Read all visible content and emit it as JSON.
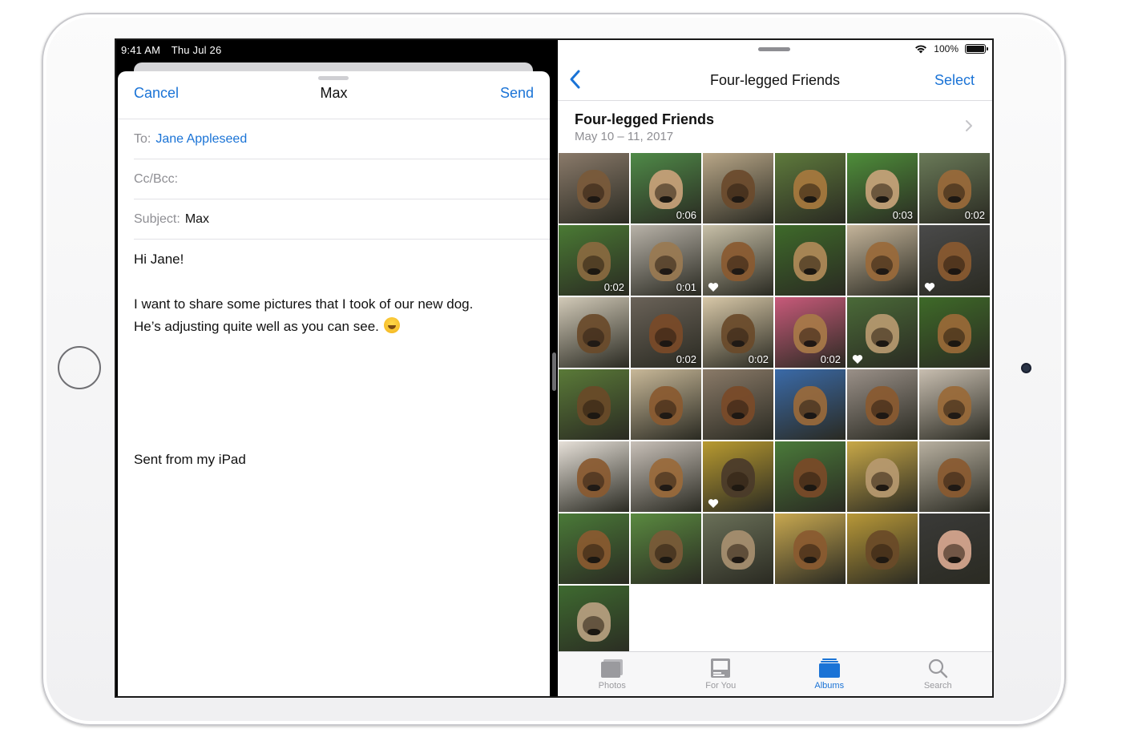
{
  "status": {
    "time": "9:41 AM",
    "date": "Thu Jul 26",
    "battery": "100%"
  },
  "mail": {
    "cancel_label": "Cancel",
    "title": "Max",
    "send_label": "Send",
    "to_label": "To:",
    "to_value": "Jane Appleseed",
    "ccbcc_label": "Cc/Bcc:",
    "subject_label": "Subject:",
    "subject_value": "Max",
    "greeting": "Hi Jane!",
    "body_line1": "I want to share some pictures that I took of our new dog.",
    "body_line2": "He’s adjusting quite well as you can see.",
    "signature": "Sent from my iPad"
  },
  "photos": {
    "nav_title": "Four-legged Friends",
    "select_label": "Select",
    "album_name": "Four-legged Friends",
    "album_dates": "May 10 – 11, 2017",
    "thumbnails": [
      {
        "bg": "#8a7a6a",
        "dog": "#7a5a3a",
        "duration": "",
        "favorite": false
      },
      {
        "bg": "#4f8a48",
        "dog": "#c9a27a",
        "duration": "0:06",
        "favorite": false
      },
      {
        "bg": "#b9a788",
        "dog": "#6b4a2c",
        "duration": "",
        "favorite": false
      },
      {
        "bg": "#5e7a3c",
        "dog": "#a8793e",
        "duration": "",
        "favorite": false
      },
      {
        "bg": "#4e8e3a",
        "dog": "#c7a37a",
        "duration": "0:03",
        "favorite": false
      },
      {
        "bg": "#6a7a58",
        "dog": "#9a6a3a",
        "duration": "0:02",
        "favorite": false
      },
      {
        "bg": "#4a7a34",
        "dog": "#8a6a40",
        "duration": "0:02",
        "favorite": false
      },
      {
        "bg": "#b8b2a8",
        "dog": "#9a7a52",
        "duration": "0:01",
        "favorite": false
      },
      {
        "bg": "#c8c0a8",
        "dog": "#8a5a30",
        "duration": "",
        "favorite": true
      },
      {
        "bg": "#3e6a2a",
        "dog": "#b08a58",
        "duration": "",
        "favorite": false
      },
      {
        "bg": "#c4b49a",
        "dog": "#9a6a3a",
        "duration": "",
        "favorite": false
      },
      {
        "bg": "#4a4a4a",
        "dog": "#8a5a30",
        "duration": "",
        "favorite": true
      },
      {
        "bg": "#d2cab8",
        "dog": "#6a4a2a",
        "duration": "",
        "favorite": false
      },
      {
        "bg": "#6a6258",
        "dog": "#7a4a28",
        "duration": "0:02",
        "favorite": false
      },
      {
        "bg": "#d8c8a8",
        "dog": "#6a4a2a",
        "duration": "0:02",
        "favorite": false
      },
      {
        "bg": "#c85a7a",
        "dog": "#a87a48",
        "duration": "0:02",
        "favorite": false
      },
      {
        "bg": "#4a6a38",
        "dog": "#b89a70",
        "duration": "",
        "favorite": true
      },
      {
        "bg": "#3e6a28",
        "dog": "#9a6a38",
        "duration": "",
        "favorite": false
      },
      {
        "bg": "#5a7a38",
        "dog": "#6a4a28",
        "duration": "",
        "favorite": false
      },
      {
        "bg": "#c8b898",
        "dog": "#8a5a30",
        "duration": "",
        "favorite": false
      },
      {
        "bg": "#8a7a68",
        "dog": "#7a4a28",
        "duration": "",
        "favorite": false
      },
      {
        "bg": "#3a6aa8",
        "dog": "#9a6a3a",
        "duration": "",
        "favorite": false
      },
      {
        "bg": "#9a9088",
        "dog": "#8a5a30",
        "duration": "",
        "favorite": false
      },
      {
        "bg": "#c8beb0",
        "dog": "#9a6a38",
        "duration": "",
        "favorite": false
      },
      {
        "bg": "#e6e0d8",
        "dog": "#8a5a30",
        "duration": "",
        "favorite": false
      },
      {
        "bg": "#c8c0b8",
        "dog": "#9a6a3a",
        "duration": "",
        "favorite": false
      },
      {
        "bg": "#b89a30",
        "dog": "#4a3a2a",
        "duration": "",
        "favorite": true
      },
      {
        "bg": "#4a7a3a",
        "dog": "#7a4a28",
        "duration": "",
        "favorite": false
      },
      {
        "bg": "#c8a848",
        "dog": "#b89a70",
        "duration": "",
        "favorite": false
      },
      {
        "bg": "#b8b0a0",
        "dog": "#8a5a30",
        "duration": "",
        "favorite": false
      },
      {
        "bg": "#4a7a38",
        "dog": "#8a5a30",
        "duration": "",
        "favorite": false
      },
      {
        "bg": "#5a8a40",
        "dog": "#7a5a38",
        "duration": "",
        "favorite": false
      },
      {
        "bg": "#6a7058",
        "dog": "#a89070",
        "duration": "",
        "favorite": false
      },
      {
        "bg": "#c8a850",
        "dog": "#8a5a30",
        "duration": "",
        "favorite": false
      },
      {
        "bg": "#b89838",
        "dog": "#6a4a28",
        "duration": "",
        "favorite": false
      },
      {
        "bg": "#3a3a38",
        "dog": "#d8a890",
        "duration": "",
        "favorite": false
      },
      {
        "bg": "#3e6a30",
        "dog": "#b8a080",
        "duration": "",
        "favorite": false
      }
    ],
    "tabs": [
      {
        "label": "Photos",
        "icon": "photos-icon",
        "active": false
      },
      {
        "label": "For You",
        "icon": "for-you-icon",
        "active": false
      },
      {
        "label": "Albums",
        "icon": "albums-icon",
        "active": true
      },
      {
        "label": "Search",
        "icon": "search-icon",
        "active": false
      }
    ]
  },
  "colors": {
    "accent": "#1a73d6",
    "secondary_text": "#8e8e93"
  }
}
